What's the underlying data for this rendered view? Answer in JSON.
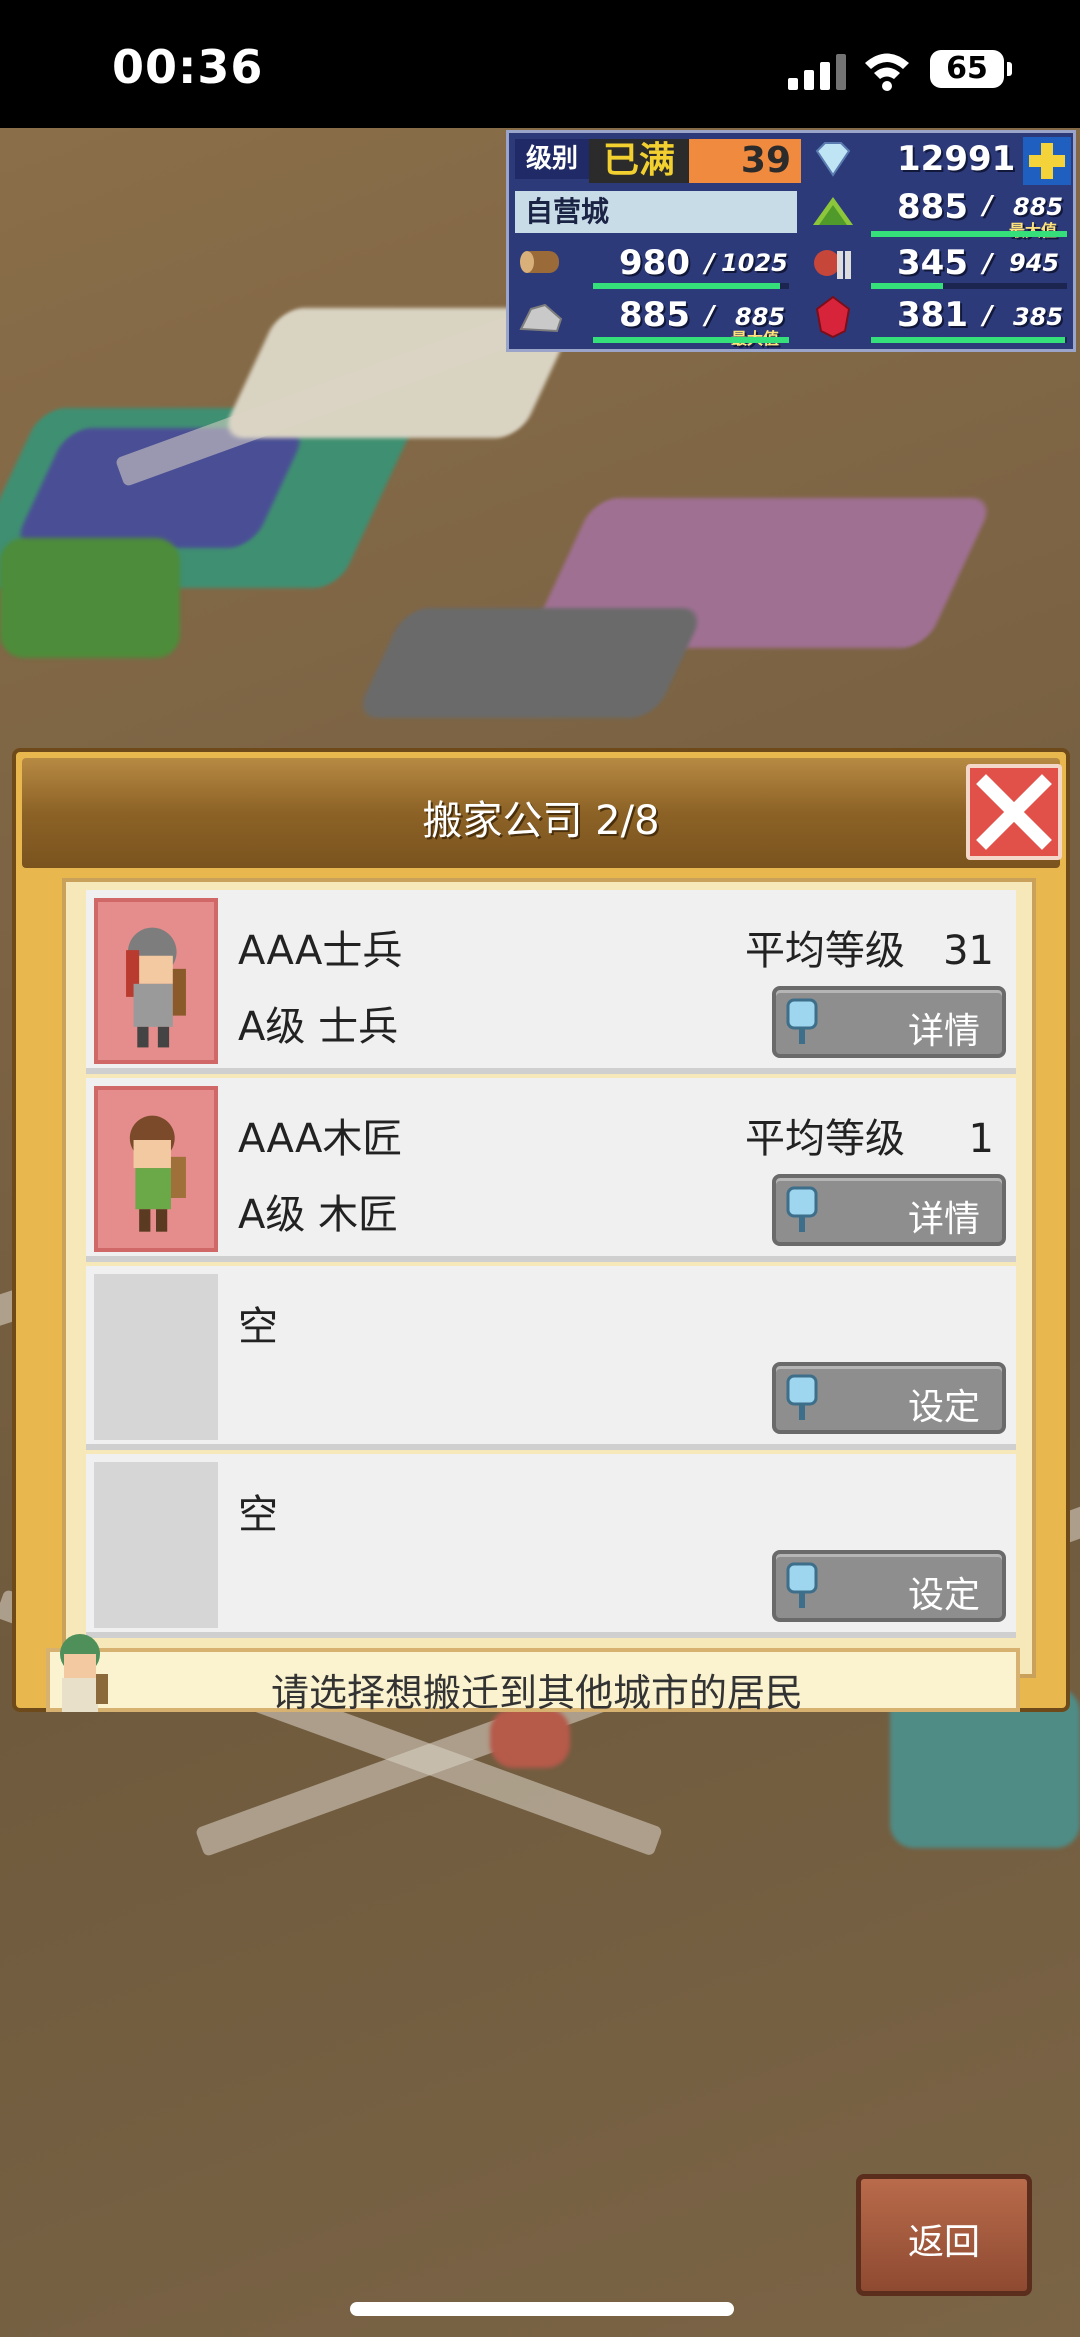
{
  "status": {
    "time": "00:36",
    "battery": "65"
  },
  "hud": {
    "level_label": "级别",
    "level_status": "已满",
    "level_value": "39",
    "gems": "12991",
    "city_name": "自营城",
    "food": "885",
    "food_max": "885",
    "food_max_note": "最大值",
    "wood": "980",
    "wood_max": "1025",
    "meat": "345",
    "meat_max": "945",
    "stone": "885",
    "stone_max": "885",
    "stone_max_note": "最大值",
    "ruby": "381",
    "ruby_max": "385"
  },
  "panel": {
    "title": "搬家公司 2/8",
    "rows": [
      {
        "name": "AAA士兵",
        "class": "A级 士兵",
        "level_label": "平均等级",
        "level": "31",
        "button": "详情"
      },
      {
        "name": "AAA木匠",
        "class": "A级 木匠",
        "level_label": "平均等级",
        "level": "1",
        "button": "详情"
      },
      {
        "name": "空",
        "button": "设定"
      },
      {
        "name": "空",
        "button": "设定"
      }
    ],
    "hint": "请选择想搬迁到其他城市的居民"
  },
  "back_label": "返回",
  "colors": {
    "hud_bg": "#2d3a7a",
    "panel_bg": "#e8b84e",
    "close_bg": "#e2504a",
    "button_bg": "#8e8e8e"
  }
}
